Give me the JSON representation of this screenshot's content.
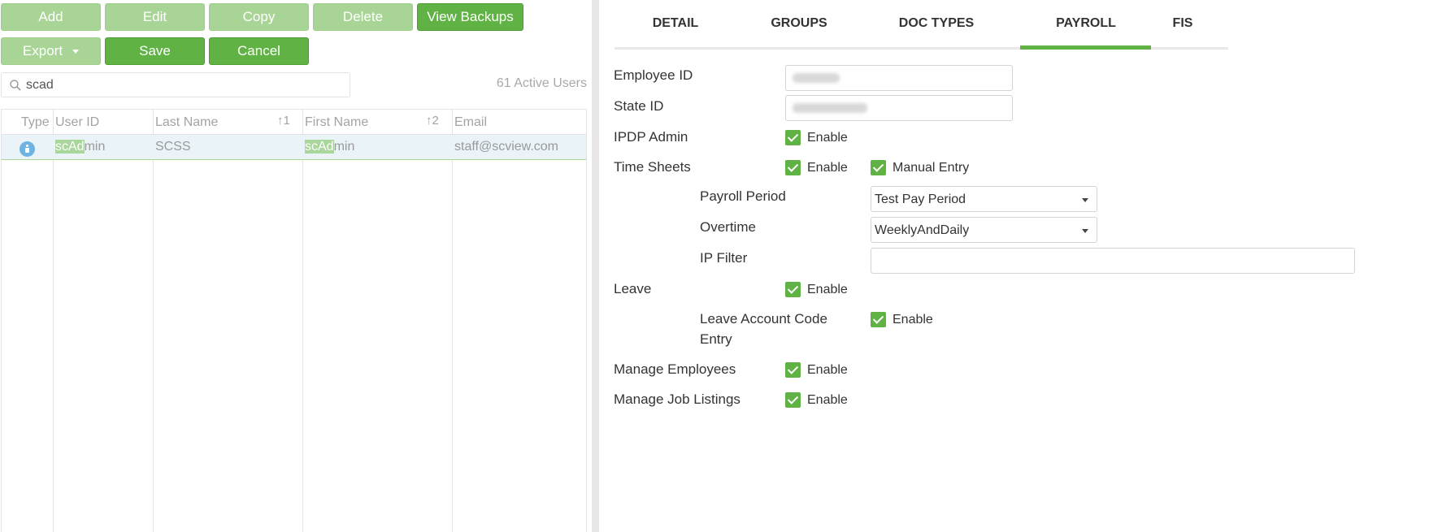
{
  "toolbar": {
    "add": "Add",
    "edit": "Edit",
    "copy": "Copy",
    "delete": "Delete",
    "view_backups": "View Backups",
    "export": "Export",
    "save": "Save",
    "cancel": "Cancel"
  },
  "search": {
    "value": "scad",
    "placeholder": ""
  },
  "active_users": "61 Active Users",
  "grid": {
    "columns": [
      "Type",
      "User ID",
      "Last Name",
      "First Name",
      "Email"
    ],
    "sort": {
      "last_name": "1",
      "first_name": "2"
    },
    "rows": [
      {
        "type_icon": "user-info-icon",
        "user_id_match": "scAd",
        "user_id_rest": "min",
        "last_name": "SCSS",
        "first_name_match": "scAd",
        "first_name_rest": "min",
        "email": "staff@scview.com"
      }
    ]
  },
  "tabs": [
    "DETAIL",
    "GROUPS",
    "DOC TYPES",
    "PAYROLL",
    "FIS"
  ],
  "active_tab": "PAYROLL",
  "form": {
    "employee_id_label": "Employee ID",
    "state_id_label": "State ID",
    "ipdp_admin_label": "IPDP Admin",
    "time_sheets_label": "Time Sheets",
    "payroll_period_label": "Payroll Period",
    "overtime_label": "Overtime",
    "ip_filter_label": "IP Filter",
    "leave_label": "Leave",
    "leave_account_code_label_1": "Leave Account Code",
    "leave_account_code_label_2": "Entry",
    "manage_employees_label": "Manage Employees",
    "manage_job_listings_label": "Manage Job Listings",
    "enable": "Enable",
    "manual_entry": "Manual Entry",
    "payroll_period_value": "Test Pay Period",
    "overtime_value": "WeeklyAndDaily",
    "ip_filter_value": ""
  },
  "colors": {
    "accent": "#5fb243",
    "accent_light": "#a8d595",
    "row_selected": "#e9f3f8"
  }
}
